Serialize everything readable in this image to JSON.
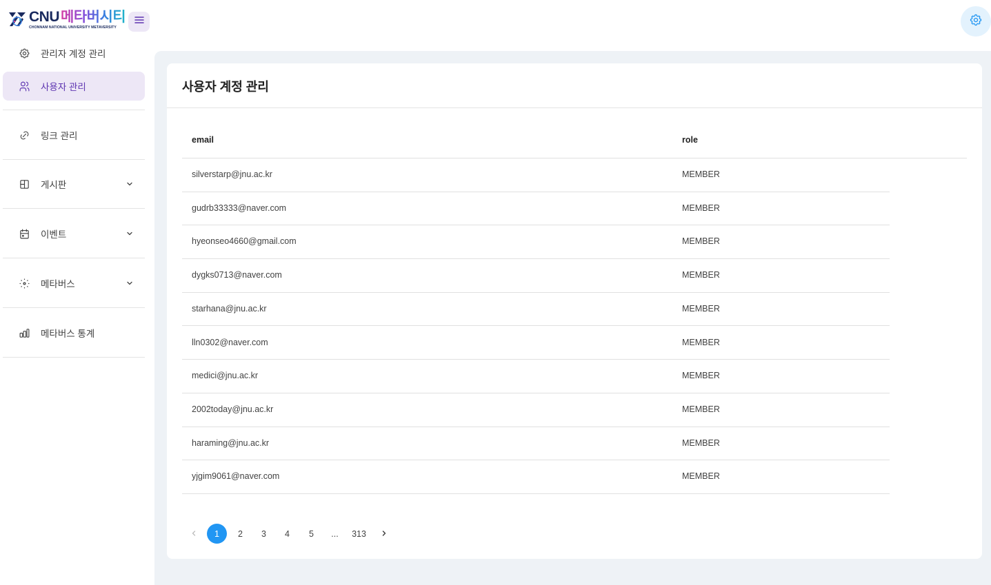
{
  "brand": {
    "name_latin": "CNU",
    "name_korean": "메타버시티",
    "subtitle": "CHONNAM NATIONAL UNIVERSITY METAVERSITY"
  },
  "sidebar": {
    "items": [
      {
        "label": "관리자 계정 관리",
        "icon": "gear-icon",
        "active": false,
        "expandable": false
      },
      {
        "label": "사용자 관리",
        "icon": "users-icon",
        "active": true,
        "expandable": false
      },
      {
        "label": "링크 관리",
        "icon": "link-icon",
        "active": false,
        "expandable": false
      },
      {
        "label": "게시판",
        "icon": "layout-icon",
        "active": false,
        "expandable": true
      },
      {
        "label": "이벤트",
        "icon": "calendar-icon",
        "active": false,
        "expandable": true
      },
      {
        "label": "메타버스",
        "icon": "dotted-circle-icon",
        "active": false,
        "expandable": true
      },
      {
        "label": "메타버스 통계",
        "icon": "bar-chart-icon",
        "active": false,
        "expandable": false
      }
    ]
  },
  "page": {
    "title": "사용자 계정 관리"
  },
  "table": {
    "columns": [
      "email",
      "role"
    ],
    "rows": [
      {
        "email": "silverstarp@jnu.ac.kr",
        "role": "MEMBER"
      },
      {
        "email": "gudrb33333@naver.com",
        "role": "MEMBER"
      },
      {
        "email": "hyeonseo4660@gmail.com",
        "role": "MEMBER"
      },
      {
        "email": "dygks0713@naver.com",
        "role": "MEMBER"
      },
      {
        "email": "starhana@jnu.ac.kr",
        "role": "MEMBER"
      },
      {
        "email": "lln0302@naver.com",
        "role": "MEMBER"
      },
      {
        "email": "medici@jnu.ac.kr",
        "role": "MEMBER"
      },
      {
        "email": "2002today@jnu.ac.kr",
        "role": "MEMBER"
      },
      {
        "email": "haraming@jnu.ac.kr",
        "role": "MEMBER"
      },
      {
        "email": "yjgim9061@naver.com",
        "role": "MEMBER"
      }
    ]
  },
  "pagination": {
    "current": "1",
    "pages": [
      "1",
      "2",
      "3",
      "4",
      "5"
    ],
    "ellipsis": "...",
    "last": "313"
  },
  "colors": {
    "accent": "#2196f3",
    "active_nav_bg": "#ede7f6",
    "active_nav_text": "#5e35b1",
    "main_bg": "#eef2f6"
  }
}
